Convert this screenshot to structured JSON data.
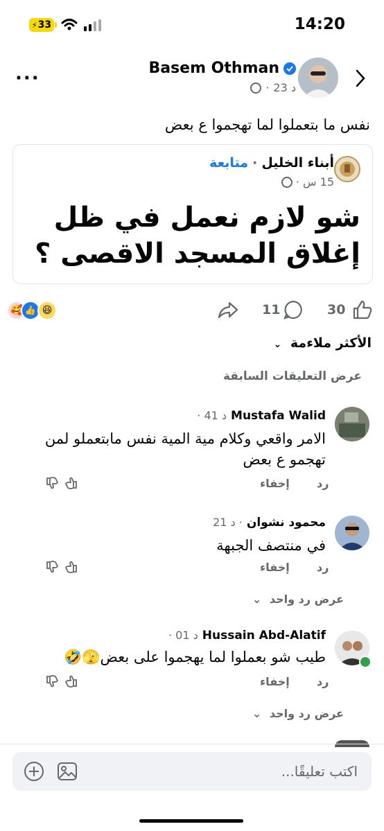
{
  "status_bar": {
    "time": "14:20",
    "battery": "33"
  },
  "post": {
    "author": "Basem Othman",
    "time": "23 د",
    "caption": "نفس ما بتعملوا لما تهجموا ع بعض",
    "shared": {
      "page_name": "أبناء الخليل",
      "follow_label": "متابعة",
      "time": "15 س",
      "text": "شو لازم نعمل في ظل إغلاق المسجد الاقصى ؟"
    },
    "likes_count": "30",
    "comments_count": "11"
  },
  "comments_section": {
    "sort_label": "الأكثر ملاءمة",
    "view_previous": "عرض التعليقات السابقة",
    "reply_label": "رد",
    "hide_label": "إخفاء",
    "view_one_reply": "عرض رد واحد",
    "comments": [
      {
        "author": "Mustafa Walid",
        "time": "41 د",
        "text": "الامر واقعي وكلام مية المية نفس مابتعملو لمن تهجمو ع بعض"
      },
      {
        "author": "محمود  نشوان",
        "time": "21 د",
        "text": "في منتصف الجبهة"
      },
      {
        "author": "Hussain Abd-Alatif",
        "time": "01 د",
        "text": "طيب شو بعملوا لما يهجموا على بعض🫣🤣"
      }
    ]
  },
  "composer": {
    "placeholder": "اكتب تعليقًا..."
  },
  "colors": {
    "accent": "#1877f2",
    "muted": "#65676b"
  }
}
